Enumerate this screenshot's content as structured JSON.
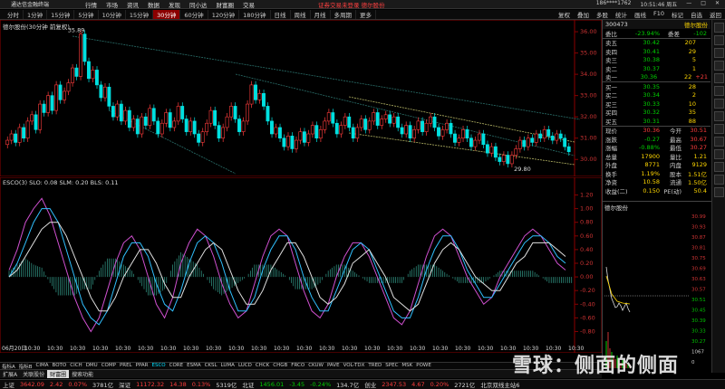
{
  "titlebar": {
    "app_name": "通达信金融终端",
    "menu": [
      "行情",
      "市场",
      "资讯",
      "数据",
      "发现",
      "同小达",
      "财富圈",
      "交易"
    ],
    "notice": "证券交易未登录 德尔股份",
    "phone": "186****1762",
    "time": "10:51:46 周五"
  },
  "toolbar": {
    "periods": [
      "分时",
      "1分钟",
      "15分钟",
      "5分钟",
      "10分钟",
      "15分钟",
      "30分钟",
      "60分钟",
      "120分钟",
      "180分钟",
      "日线",
      "周线",
      "月线",
      "多周期",
      "更多"
    ],
    "active_index": 6,
    "tools": [
      "复权",
      "叠加",
      "多股",
      "统计",
      "画线",
      "F10",
      "标记",
      "自选",
      "返回"
    ]
  },
  "main_chart": {
    "title": "德尔股份(30分钟 前复权)",
    "high_label": "35.89",
    "low_label": "29.80",
    "y_ticks": [
      "36.00",
      "35.00",
      "34.00",
      "33.00",
      "32.00",
      "31.00",
      "30.00"
    ]
  },
  "indicator": {
    "title": "ESCO(3) SLO: 0.08 SLM: 0.20 BLS: 0.11",
    "y_ticks": [
      "1.20",
      "1.00",
      "0.80",
      "0.60",
      "0.40",
      "0.20",
      "0.00",
      "-0.20",
      "-0.40",
      "-0.60",
      "-0.80"
    ],
    "x_labels": [
      "06月20日",
      "10:30",
      "10:30",
      "10:30",
      "10:30",
      "10:30",
      "10:30",
      "10:30",
      "10:30",
      "10:30",
      "10:30",
      "10:30",
      "10:30",
      "10:30",
      "10:30",
      "10:30",
      "10:30",
      "10:30",
      "10:30",
      "10:30",
      "10:30",
      "10:30",
      "10:30",
      "10:30",
      "10:30",
      "10:30"
    ]
  },
  "indicator_tabs": [
    "指标A",
    "指标B",
    "CIMA",
    "BOTO",
    "CICH",
    "DMU",
    "COMP",
    "PREL",
    "PPAR",
    "ESCO",
    "CORE",
    "ESMA",
    "CKSL",
    "LUMA",
    "LUCD",
    "CHCK",
    "CHGB",
    "FRCO",
    "CKUW",
    "PAVE",
    "VOL-TDX",
    "TRED",
    "SPEC",
    "MSK",
    "POWE"
  ],
  "bottom_tabs": [
    "扩展A",
    "关联股份",
    "财富圈",
    "搜索功能"
  ],
  "quote": {
    "code": "300473",
    "name": "德尔股份",
    "wei_bi_label": "委比",
    "wei_bi": "-23.94%",
    "wei_cha_label": "委差",
    "wei_cha": "-102",
    "asks": [
      {
        "label": "卖五",
        "price": "30.42",
        "vol": "207"
      },
      {
        "label": "卖四",
        "price": "30.41",
        "vol": "29"
      },
      {
        "label": "卖三",
        "price": "30.38",
        "vol": "5"
      },
      {
        "label": "卖二",
        "price": "30.37",
        "vol": "1"
      },
      {
        "label": "卖一",
        "price": "30.36",
        "vol": "22",
        "extra": "+21"
      }
    ],
    "bids": [
      {
        "label": "买一",
        "price": "30.35",
        "vol": "28"
      },
      {
        "label": "买二",
        "price": "30.34",
        "vol": "2"
      },
      {
        "label": "买三",
        "price": "30.33",
        "vol": "10"
      },
      {
        "label": "买四",
        "price": "30.32",
        "vol": "35"
      },
      {
        "label": "买五",
        "price": "30.31",
        "vol": "88"
      }
    ],
    "stats": [
      {
        "l1": "现价",
        "v1": "30.36",
        "l2": "今开",
        "v2": "30.51"
      },
      {
        "l1": "涨跌",
        "v1": "-0.27",
        "l2": "最高",
        "v2": "30.67"
      },
      {
        "l1": "涨幅",
        "v1": "-0.88%",
        "l2": "最低",
        "v2": "30.27"
      },
      {
        "l1": "总量",
        "v1": "17900",
        "l2": "量比",
        "v2": "1.21"
      },
      {
        "l1": "外盘",
        "v1": "8771",
        "l2": "内盘",
        "v2": "9129"
      },
      {
        "l1": "换手",
        "v1": "1.19%",
        "l2": "股本",
        "v2": "1.51亿"
      },
      {
        "l1": "净资",
        "v1": "10.58",
        "l2": "流通",
        "v2": "1.50亿"
      },
      {
        "l1": "收益(二)",
        "v1": "0.150",
        "l2": "PE(动)",
        "v2": "50.4"
      }
    ],
    "mini_title": "德尔股份",
    "mini_ticks": [
      "30.99",
      "30.93",
      "30.87",
      "30.81",
      "30.75",
      "30.69",
      "30.63",
      "30.57",
      "30.51",
      "30.45",
      "30.39",
      "30.33",
      "30.27",
      "1067",
      "0"
    ]
  },
  "status": {
    "sh_label": "上证",
    "sh": "3642.09",
    "sh_chg": "2.42",
    "sh_pct": "0.07%",
    "sh_amt": "3781亿",
    "sz_label": "深证",
    "sz": "11172.32",
    "sz_chg": "14.38",
    "sz_pct": "0.13%",
    "sz_amt": "5319亿",
    "bz_label": "北证",
    "bz": "1456.01",
    "bz_chg": "-3.45",
    "bz_pct": "-0.24%",
    "bz_amt": "134.7亿",
    "cy_label": "创业",
    "cy": "2347.53",
    "cy_chg": "4.67",
    "cy_pct": "0.20%",
    "cy_amt": "2721亿",
    "extra": "北京双线主站6"
  },
  "watermark": "雪球：侧面的侧面",
  "chart_data": [
    {
      "type": "candlestick",
      "title": "德尔股份(30分钟 前复权)",
      "ylim": [
        29.5,
        36.3
      ],
      "closes": [
        30.9,
        31.2,
        30.8,
        31.5,
        31.0,
        31.8,
        32.1,
        31.4,
        32.6,
        32.2,
        33.0,
        32.3,
        33.5,
        32.8,
        33.2,
        33.6,
        34.3,
        33.9,
        35.89,
        34.6,
        33.8,
        34.2,
        33.5,
        32.9,
        33.4,
        32.5,
        32.0,
        32.6,
        31.8,
        32.3,
        31.5,
        31.9,
        31.2,
        32.0,
        31.6,
        32.4,
        31.8,
        31.2,
        31.7,
        32.2,
        31.5,
        31.8,
        32.5,
        31.9,
        31.3,
        31.8,
        31.2,
        30.8,
        31.3,
        31.7,
        32.3,
        31.6,
        31.0,
        31.5,
        32.0,
        32.5,
        31.9,
        31.3,
        31.8,
        32.6,
        33.5,
        32.8,
        33.1,
        32.5,
        31.8,
        31.2,
        31.5,
        31.0,
        30.6,
        31.1,
        30.5,
        30.9,
        31.3,
        30.8,
        31.2,
        31.6,
        31.0,
        31.4,
        31.8,
        32.2,
        31.7,
        31.2,
        31.6,
        32.0,
        31.5,
        31.0,
        31.5,
        31.9,
        31.4,
        31.8,
        32.2,
        31.6,
        31.9,
        32.1,
        31.7,
        32.0,
        31.5,
        31.2,
        31.6,
        31.0,
        31.4,
        31.8,
        31.3,
        31.7,
        32.0,
        31.5,
        31.1,
        31.4,
        31.7,
        31.2,
        30.8,
        31.0,
        31.4,
        31.0,
        30.6,
        30.9,
        31.2,
        30.7,
        30.3,
        30.6,
        30.1,
        29.9,
        30.2,
        29.8,
        30.2,
        30.5,
        30.9,
        30.6,
        31.0,
        30.8,
        31.2,
        31.0,
        31.4,
        31.1,
        30.9,
        31.2,
        31.0,
        30.6,
        30.36
      ]
    },
    {
      "type": "line",
      "title": "ESCO(3) SLO: 0.08 SLM: 0.20 BLS: 0.11",
      "ylim": [
        -0.9,
        1.3
      ],
      "series": [
        {
          "name": "SLO",
          "color": "#d050d0",
          "values": [
            0.1,
            0.4,
            0.8,
            1.0,
            1.15,
            0.9,
            0.5,
            0.1,
            -0.3,
            -0.6,
            -0.8,
            -0.6,
            -0.2,
            0.2,
            0.5,
            0.6,
            0.4,
            0.0,
            -0.4,
            -0.6,
            -0.3,
            0.2,
            0.5,
            0.7,
            0.6,
            0.3,
            -0.1,
            -0.4,
            -0.6,
            -0.5,
            -0.1,
            0.3,
            0.6,
            0.7,
            0.6,
            0.2,
            -0.2,
            -0.5,
            -0.6,
            -0.4,
            0.0,
            0.3,
            0.5,
            0.5,
            0.3,
            0.0,
            -0.3,
            -0.6,
            -0.7,
            -0.5,
            -0.1,
            0.3,
            0.6,
            0.7,
            0.6,
            0.3,
            0.0,
            -0.2,
            -0.4,
            -0.3,
            0.0,
            0.2,
            0.4,
            0.6,
            0.7,
            0.6,
            0.4,
            0.2,
            0.1
          ]
        },
        {
          "name": "SLM",
          "color": "#30c0ff",
          "values": [
            0.0,
            0.2,
            0.5,
            0.8,
            1.0,
            1.0,
            0.8,
            0.4,
            0.0,
            -0.4,
            -0.6,
            -0.7,
            -0.5,
            -0.1,
            0.3,
            0.5,
            0.5,
            0.3,
            -0.1,
            -0.4,
            -0.5,
            -0.2,
            0.2,
            0.5,
            0.6,
            0.5,
            0.2,
            -0.2,
            -0.5,
            -0.5,
            -0.3,
            0.1,
            0.4,
            0.6,
            0.6,
            0.4,
            0.0,
            -0.3,
            -0.5,
            -0.5,
            -0.2,
            0.1,
            0.4,
            0.5,
            0.4,
            0.1,
            -0.2,
            -0.5,
            -0.6,
            -0.6,
            -0.3,
            0.1,
            0.4,
            0.6,
            0.6,
            0.4,
            0.1,
            -0.1,
            -0.3,
            -0.3,
            -0.1,
            0.1,
            0.3,
            0.5,
            0.6,
            0.6,
            0.5,
            0.3,
            0.2
          ]
        },
        {
          "name": "BLS",
          "color": "#e0e0e0",
          "values": [
            0.0,
            0.1,
            0.3,
            0.5,
            0.7,
            0.8,
            0.8,
            0.6,
            0.3,
            0.0,
            -0.3,
            -0.5,
            -0.5,
            -0.3,
            0.0,
            0.2,
            0.4,
            0.4,
            0.2,
            -0.1,
            -0.3,
            -0.3,
            0.0,
            0.2,
            0.4,
            0.5,
            0.4,
            0.1,
            -0.2,
            -0.4,
            -0.4,
            -0.2,
            0.1,
            0.3,
            0.5,
            0.5,
            0.3,
            0.0,
            -0.3,
            -0.4,
            -0.3,
            -0.1,
            0.2,
            0.3,
            0.4,
            0.2,
            0.0,
            -0.3,
            -0.4,
            -0.5,
            -0.4,
            -0.1,
            0.2,
            0.4,
            0.5,
            0.4,
            0.2,
            0.0,
            -0.1,
            -0.2,
            -0.2,
            0.0,
            0.2,
            0.3,
            0.5,
            0.5,
            0.5,
            0.4,
            0.3
          ]
        }
      ]
    }
  ]
}
